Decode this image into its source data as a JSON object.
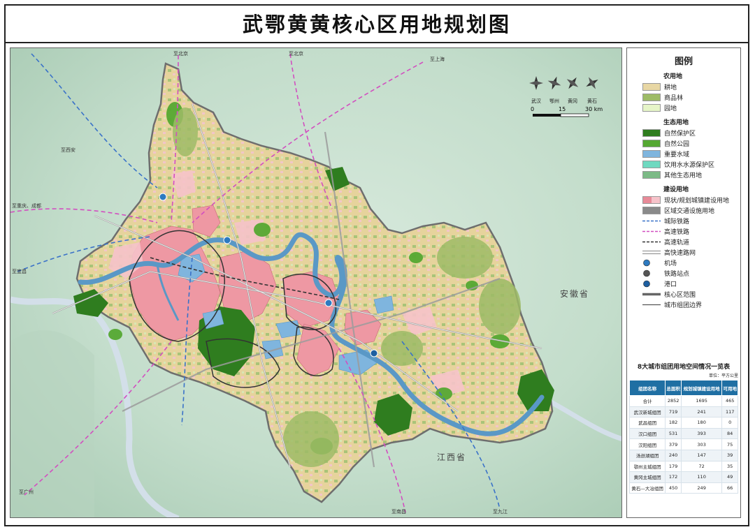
{
  "title": "武鄂黄黄核心区用地规划图",
  "map": {
    "direction_labels": [
      {
        "id": "beijing1",
        "text": "至北京"
      },
      {
        "id": "beijing2",
        "text": "至北京"
      },
      {
        "id": "shanghai",
        "text": "至上海"
      },
      {
        "id": "xian",
        "text": "至西安"
      },
      {
        "id": "chongqing",
        "text": "至重庆、成都"
      },
      {
        "id": "yichang",
        "text": "至宜昌"
      },
      {
        "id": "guangzhou",
        "text": "至广州"
      },
      {
        "id": "nanchang",
        "text": "至南昌"
      },
      {
        "id": "jiujiang",
        "text": "至九江"
      }
    ],
    "province_labels": {
      "anhui": "安徽省",
      "jiangxi": "江西省"
    },
    "scale": {
      "cities": [
        "武汉",
        "鄂州",
        "黄冈",
        "黄石"
      ],
      "ticks": [
        "0",
        "15",
        "30 km"
      ]
    }
  },
  "legend": {
    "title": "图例",
    "groups": [
      {
        "name": "农用地",
        "items": [
          {
            "label": "耕地",
            "kind": "fill",
            "color": "#e8d7a4"
          },
          {
            "label": "商品林",
            "kind": "fill",
            "color": "#9dbb66"
          },
          {
            "label": "园地",
            "kind": "fill",
            "color": "#e6f5c8"
          }
        ]
      },
      {
        "name": "生态用地",
        "items": [
          {
            "label": "自然保护区",
            "kind": "fill",
            "color": "#2f7d1f"
          },
          {
            "label": "自然公园",
            "kind": "fill",
            "color": "#55a832"
          },
          {
            "label": "重要水域",
            "kind": "fill",
            "color": "#7fb5de"
          },
          {
            "label": "饮用水水源保护区",
            "kind": "fill",
            "color": "#6fd9c0"
          },
          {
            "label": "其他生态用地",
            "kind": "fill",
            "color": "#7cba86"
          }
        ]
      },
      {
        "name": "建设用地",
        "items": [
          {
            "label": "现状/规划城镇建设用地",
            "kind": "fill2",
            "color": "#e88a98",
            "color2": "#f6c3ca"
          },
          {
            "label": "区域交通设施用地",
            "kind": "fill",
            "color": "#8a8a8a"
          },
          {
            "label": "城际铁路",
            "kind": "dash",
            "color": "#3a72c8"
          },
          {
            "label": "高速铁路",
            "kind": "dash",
            "color": "#d24fc0"
          },
          {
            "label": "高速轨道",
            "kind": "dash",
            "color": "#333333"
          },
          {
            "label": "高快速路网",
            "kind": "double",
            "color": "#888888"
          },
          {
            "label": "机场",
            "kind": "circle",
            "color": "#2d7ac0"
          },
          {
            "label": "铁路站点",
            "kind": "circle",
            "color": "#555555"
          },
          {
            "label": "港口",
            "kind": "circle",
            "color": "#1e5fa0"
          },
          {
            "label": "核心区范围",
            "kind": "thick",
            "color": "#666666"
          },
          {
            "label": "城市组团边界",
            "kind": "thin",
            "color": "#555555"
          }
        ]
      }
    ]
  },
  "table": {
    "title": "8大城市组团用地空间情况一览表",
    "unit": "单位：平方公里",
    "headers": [
      "组团名称",
      "总面积",
      "规划城镇建设用地",
      "可用地"
    ],
    "rows": [
      [
        "合计",
        "2852",
        "1695",
        "465"
      ],
      [
        "武汉新城组团",
        "719",
        "241",
        "117"
      ],
      [
        "武昌组团",
        "182",
        "180",
        "0"
      ],
      [
        "汉口组团",
        "531",
        "393",
        "84"
      ],
      [
        "汉阳组团",
        "379",
        "303",
        "75"
      ],
      [
        "汤逊湖组团",
        "240",
        "147",
        "39"
      ],
      [
        "鄂州主城组团",
        "179",
        "72",
        "35"
      ],
      [
        "黄冈主城组团",
        "172",
        "110",
        "49"
      ],
      [
        "黄石—大冶组团",
        "450",
        "249",
        "66"
      ]
    ]
  }
}
